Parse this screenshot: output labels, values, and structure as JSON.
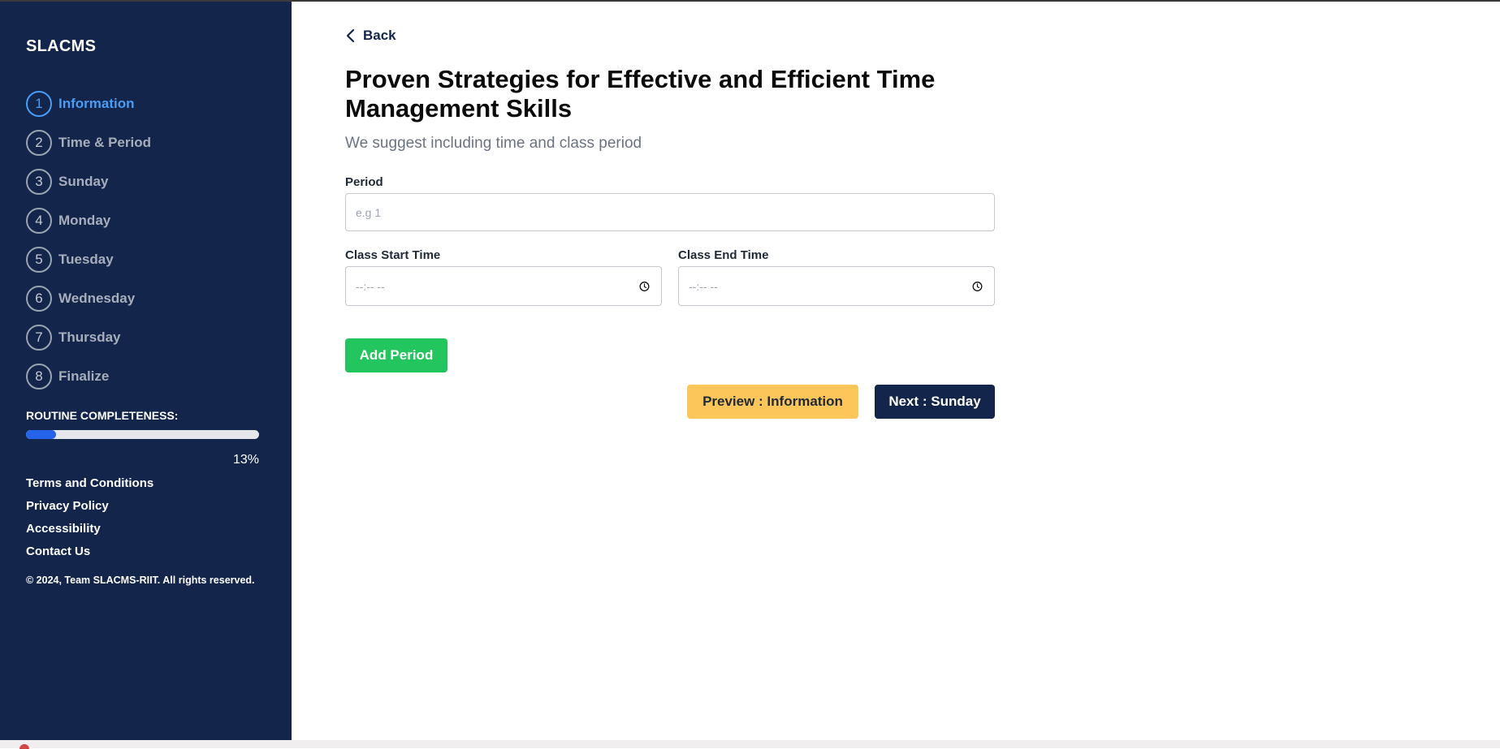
{
  "sidebar": {
    "brand": "SLACMS",
    "steps": [
      {
        "num": "1",
        "label": "Information"
      },
      {
        "num": "2",
        "label": "Time & Period"
      },
      {
        "num": "3",
        "label": "Sunday"
      },
      {
        "num": "4",
        "label": "Monday"
      },
      {
        "num": "5",
        "label": "Tuesday"
      },
      {
        "num": "6",
        "label": "Wednesday"
      },
      {
        "num": "7",
        "label": "Thursday"
      },
      {
        "num": "8",
        "label": "Finalize"
      }
    ],
    "active_step": 0,
    "completeness_label": "ROUTINE COMPLETENESS:",
    "completeness_value": 13,
    "completeness_text": "13%",
    "links": [
      "Terms and Conditions",
      "Privacy Policy",
      "Accessibility",
      "Contact Us"
    ],
    "copyright": "© 2024, Team SLACMS-RIIT. All rights reserved."
  },
  "main": {
    "back_label": "Back",
    "title": "Proven Strategies for Effective and Efficient Time Management Skills",
    "subtitle": "We suggest including time and class period",
    "period_label": "Period",
    "period_placeholder": "e.g 1",
    "start_label": "Class Start Time",
    "start_value": "--:-- --",
    "end_label": "Class End Time",
    "end_value": "--:-- --",
    "add_period": "Add Period",
    "preview_button": "Preview : Information",
    "next_button": "Next : Sunday"
  },
  "colors": {
    "sidebar_bg": "#13254a",
    "active": "#4a9cf5",
    "green": "#22c55e",
    "yellow": "#fcc65a",
    "navy": "#13254a",
    "progress": "#2563eb"
  }
}
